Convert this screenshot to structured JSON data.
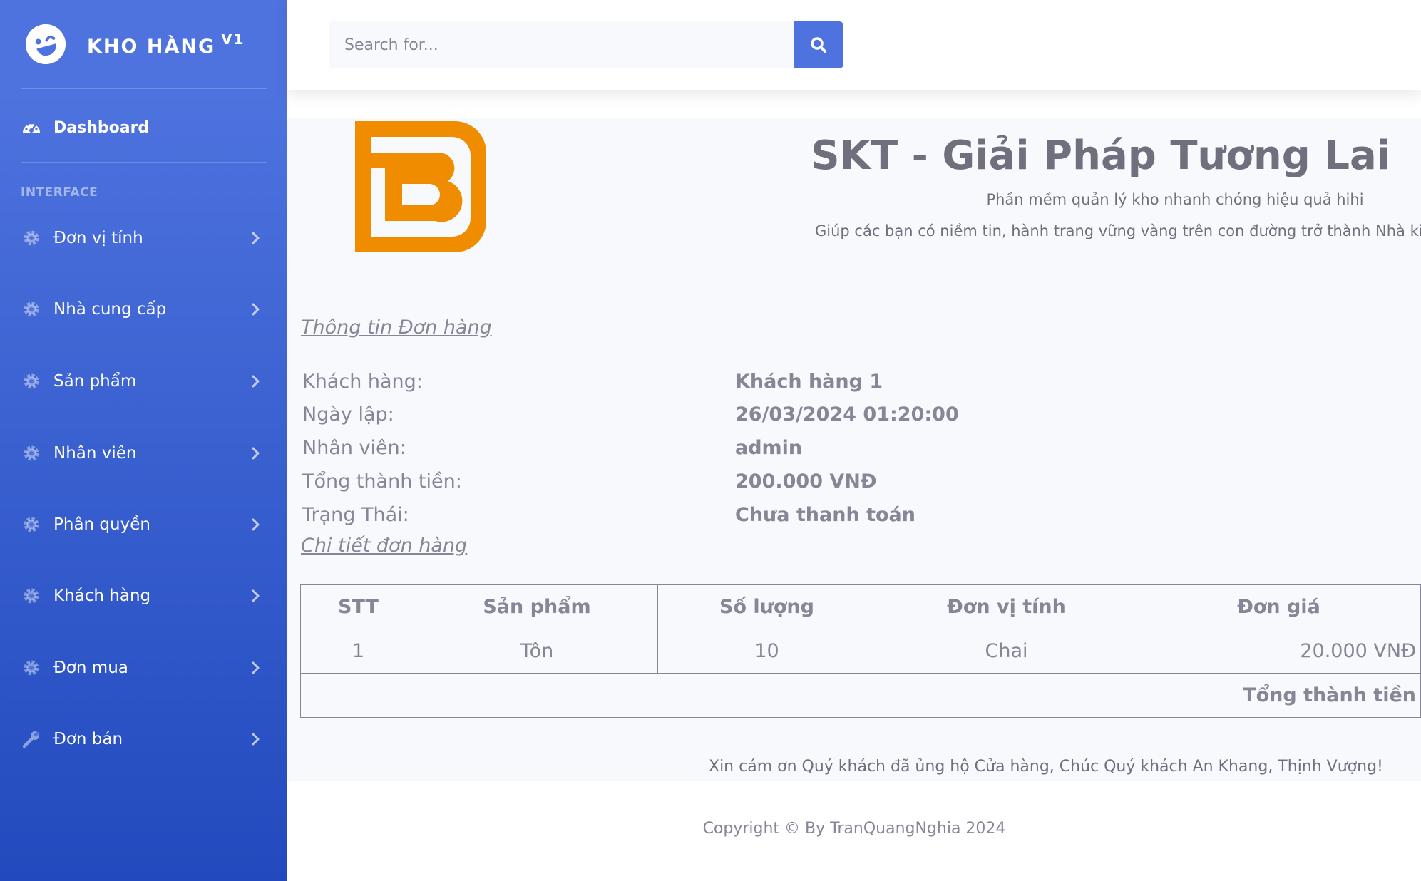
{
  "brand": {
    "name": "Kho hàng",
    "version": "V1"
  },
  "sidebar": {
    "dashboard": "Dashboard",
    "heading": "Interface",
    "items": [
      {
        "label": "Đơn vị tính",
        "icon": "gear-icon"
      },
      {
        "label": "Nhà cung cấp",
        "icon": "gear-icon"
      },
      {
        "label": "Sản phẩm",
        "icon": "gear-icon"
      },
      {
        "label": "Nhân viên",
        "icon": "gear-icon"
      },
      {
        "label": "Phân quyền",
        "icon": "gear-icon"
      },
      {
        "label": "Khách hàng",
        "icon": "gear-icon"
      },
      {
        "label": "Đơn mua",
        "icon": "gear-icon"
      },
      {
        "label": "Đơn bán",
        "icon": "wrench-icon"
      }
    ]
  },
  "search": {
    "placeholder": "Search for..."
  },
  "company": {
    "title": "SKT - Giải Pháp Tương Lai",
    "subtitle1": "Phần mềm quản lý kho nhanh chóng hiệu quả hihi",
    "subtitle2": "Giúp các bạn có niềm tin, hành trang vững vàng trên con đường trở thành Nhà kinh"
  },
  "order": {
    "section_title": "Thông tin Đơn hàng",
    "fields": [
      {
        "label": "Khách hàng:",
        "value": "Khách hàng 1"
      },
      {
        "label": "Ngày lập:",
        "value": "26/03/2024 01:20:00"
      },
      {
        "label": "Nhân viên:",
        "value": "admin"
      },
      {
        "label": "Tổng thành tiền:",
        "value": "200.000 VNĐ"
      },
      {
        "label": "Trạng Thái:",
        "value": "Chưa thanh toán"
      }
    ],
    "detail_title": "Chi tiết đơn hàng",
    "table": {
      "headers": [
        "STT",
        "Sản phẩm",
        "Số lượng",
        "Đơn vị tính",
        "Đơn giá"
      ],
      "rows": [
        [
          "1",
          "Tôn",
          "10",
          "Chai",
          "20.000 VNĐ"
        ]
      ],
      "total_label": "Tổng thành tiền"
    }
  },
  "thanks": "Xin cám ơn Quý khách đã ủng hộ Cửa hàng, Chúc Quý khách An Khang, Thịnh Vượng!",
  "footer": "Copyright © By TranQuangNghia 2024",
  "colors": {
    "primary": "#4e73df",
    "primary_dark": "#224abe",
    "logo_orange": "#f08c00",
    "text": "#858796"
  }
}
